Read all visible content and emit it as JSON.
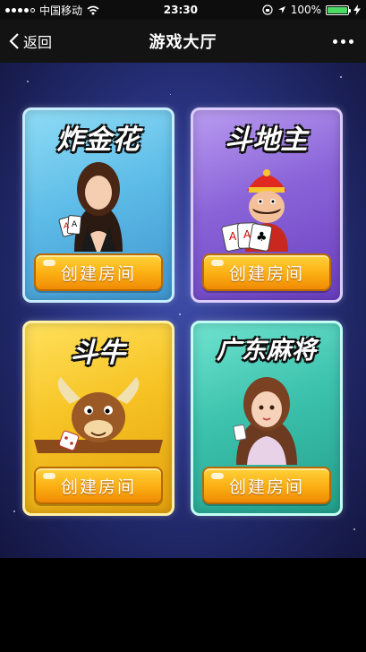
{
  "status_bar": {
    "carrier": "中国移动",
    "time": "23:30",
    "battery": "100%",
    "battery_level": 1.0
  },
  "nav": {
    "back_label": "返回",
    "title": "游戏大厅"
  },
  "games": [
    {
      "id": "zhajinhua",
      "title": "炸金花",
      "button_label": "创建房间"
    },
    {
      "id": "doudizhu",
      "title": "斗地主",
      "button_label": "创建房间"
    },
    {
      "id": "douniu",
      "title": "斗牛",
      "button_label": "创建房间"
    },
    {
      "id": "guangdong-mahjong",
      "title": "广东麻将",
      "button_label": "创建房间"
    }
  ],
  "colors": {
    "battery_green": "#4cd964",
    "button_orange": "#fbae12",
    "background_blue": "#2b3686"
  },
  "icons": [
    "back-chevron-icon",
    "more-dots-icon",
    "wifi-icon",
    "location-icon",
    "lock-rotation-icon",
    "charging-icon"
  ]
}
